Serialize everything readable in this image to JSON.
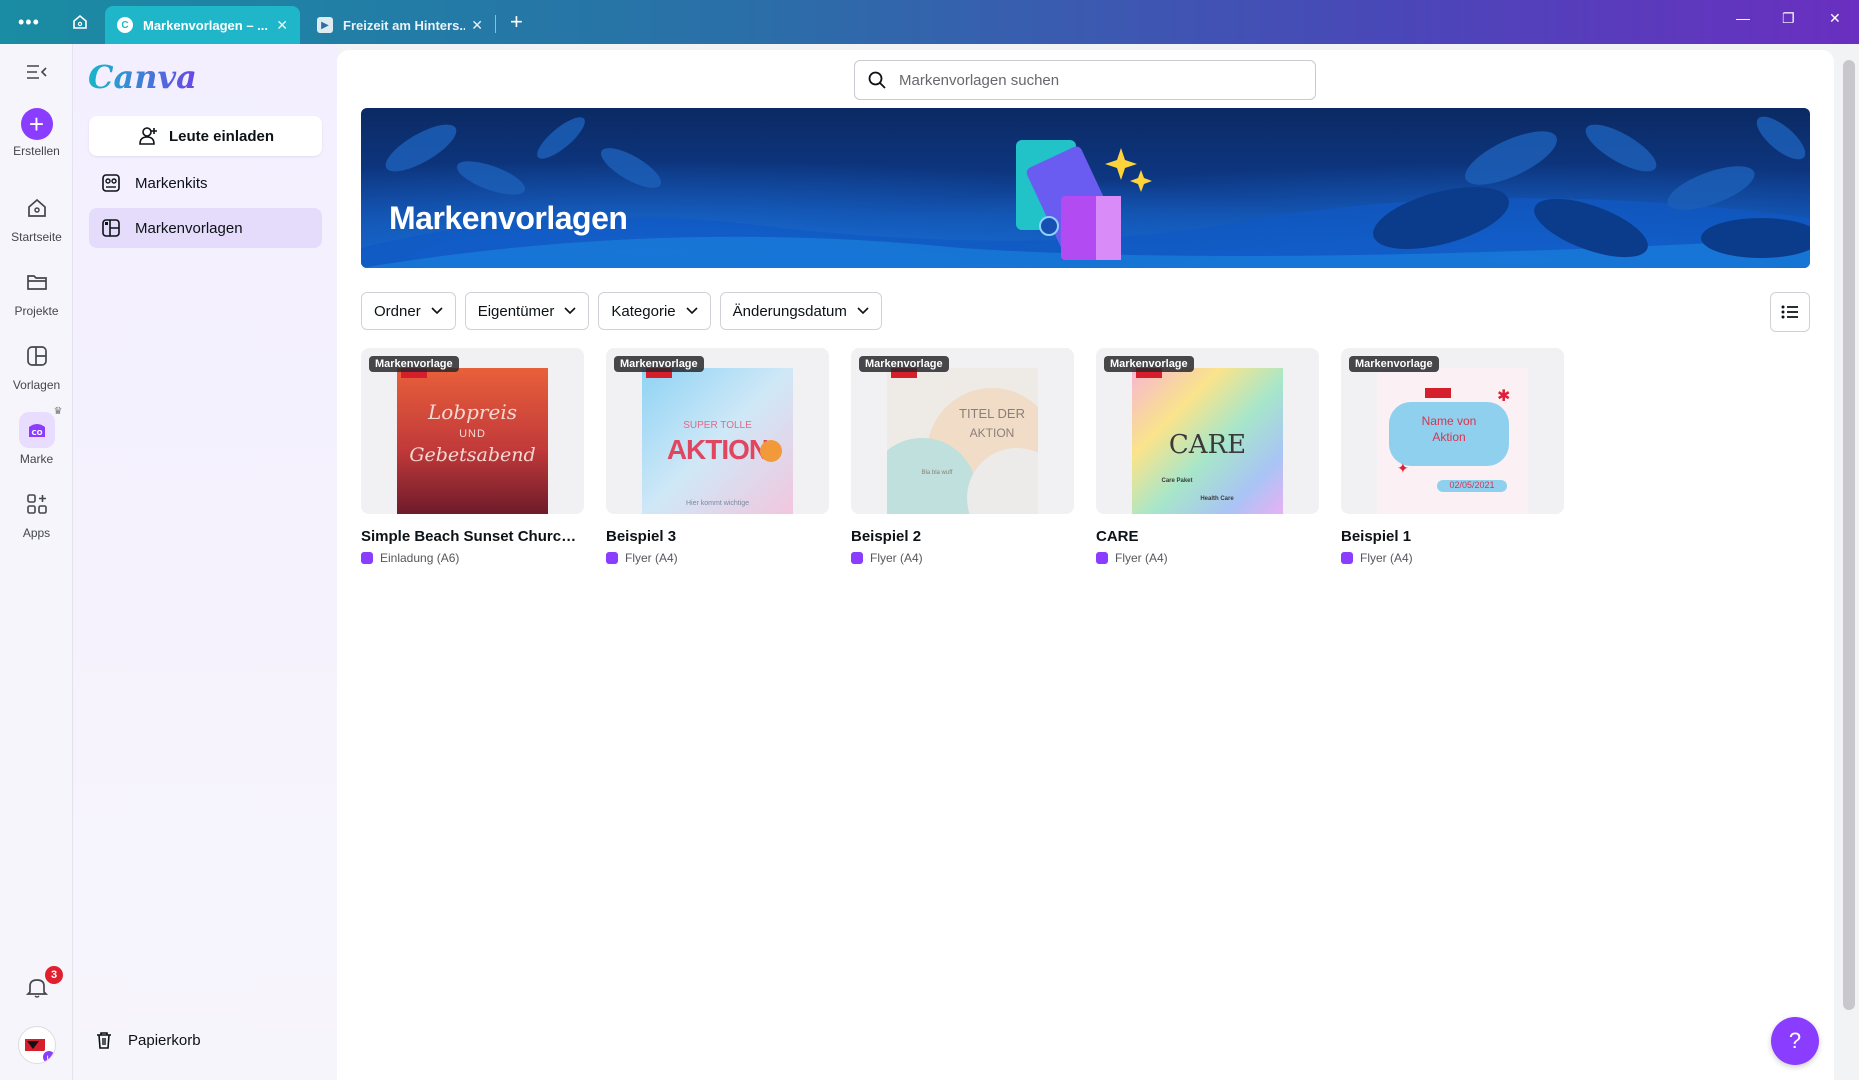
{
  "titlebar": {
    "tabs": [
      {
        "title": "Markenvorlagen – ...",
        "icon": "canva-icon",
        "active": true
      },
      {
        "title": "Freizeit am Hinters...",
        "icon": "video-icon",
        "active": false
      }
    ]
  },
  "rail": {
    "items": [
      {
        "label": "Erstellen",
        "icon": "plus-icon"
      },
      {
        "label": "Startseite",
        "icon": "home-icon"
      },
      {
        "label": "Projekte",
        "icon": "folder-icon"
      },
      {
        "label": "Vorlagen",
        "icon": "templates-icon"
      },
      {
        "label": "Marke",
        "icon": "brand-icon"
      },
      {
        "label": "Apps",
        "icon": "apps-icon"
      }
    ],
    "notification_count": "3"
  },
  "panel": {
    "logo": "Canva",
    "invite_label": "Leute einladen",
    "nav": [
      {
        "label": "Markenkits"
      },
      {
        "label": "Markenvorlagen"
      }
    ],
    "trash_label": "Papierkorb"
  },
  "main": {
    "search_placeholder": "Markenvorlagen suchen",
    "banner_title": "Markenvorlagen",
    "filters": [
      "Ordner",
      "Eigentümer",
      "Kategorie",
      "Änderungsdatum"
    ],
    "cards": [
      {
        "tag": "Markenvorlage",
        "title": "Simple Beach Sunset Church I...",
        "subtitle": "Einladung (A6)",
        "thumb_text1": "Lobpreis",
        "thumb_text2": "UND",
        "thumb_text3": "Gebetsabend"
      },
      {
        "tag": "Markenvorlage",
        "title": "Beispiel 3",
        "subtitle": "Flyer (A4)",
        "thumb_text1": "SUPER TOLLE",
        "thumb_text2": "AKTION",
        "thumb_text3": "Hier kommt wichtige"
      },
      {
        "tag": "Markenvorlage",
        "title": "Beispiel 2",
        "subtitle": "Flyer (A4)",
        "thumb_text1": "TITEL DER",
        "thumb_text2": "AKTION",
        "thumb_text3": "Bla bla wuff"
      },
      {
        "tag": "Markenvorlage",
        "title": "CARE",
        "subtitle": "Flyer (A4)",
        "thumb_text1": "CARE",
        "thumb_text2": "Care Paket",
        "thumb_text3": "Health Care"
      },
      {
        "tag": "Markenvorlage",
        "title": "Beispiel 1",
        "subtitle": "Flyer (A4)",
        "thumb_text1": "Name von",
        "thumb_text2": "Aktion",
        "thumb_text3": "02/05/2021"
      }
    ]
  },
  "help_label": "?",
  "colors": {
    "accent": "#8b3dff",
    "tab_active": "#1fb6c9"
  }
}
